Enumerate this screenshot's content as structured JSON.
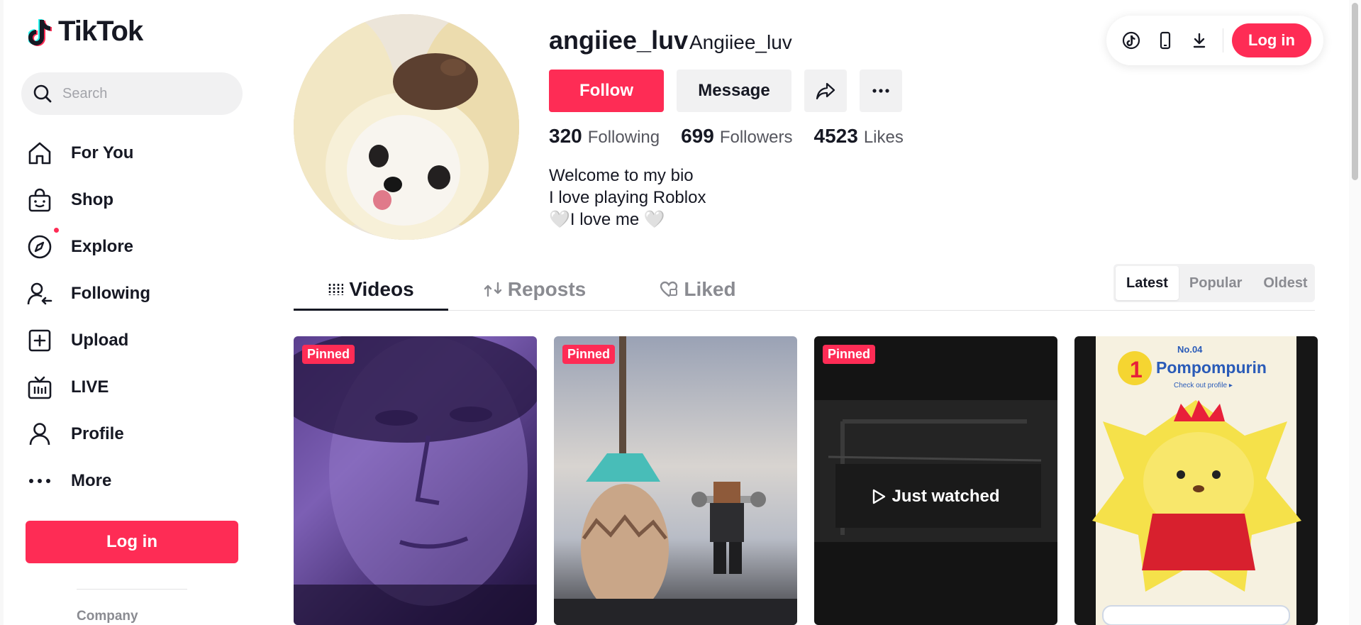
{
  "sidebar": {
    "logo": "TikTok",
    "search_placeholder": "Search",
    "items": [
      {
        "label": "For You",
        "icon": "home-icon"
      },
      {
        "label": "Shop",
        "icon": "shop-bag-icon"
      },
      {
        "label": "Explore",
        "icon": "compass-icon"
      },
      {
        "label": "Following",
        "icon": "following-user-icon"
      },
      {
        "label": "Upload",
        "icon": "upload-plus-icon"
      },
      {
        "label": "LIVE",
        "icon": "live-tv-icon"
      },
      {
        "label": "Profile",
        "icon": "profile-user-icon"
      },
      {
        "label": "More",
        "icon": "more-dots-icon"
      }
    ],
    "login_label": "Log in",
    "company_label": "Company"
  },
  "topbar": {
    "icons": [
      "tiktok-coin-icon",
      "mobile-phone-icon",
      "download-icon"
    ],
    "login_label": "Log in"
  },
  "profile": {
    "username": "angiiee_luv",
    "nickname": "Angiiee_luv",
    "follow_label": "Follow",
    "message_label": "Message",
    "stats": [
      {
        "value": "320",
        "label": "Following"
      },
      {
        "value": "699",
        "label": "Followers"
      },
      {
        "value": "4523",
        "label": "Likes"
      }
    ],
    "bio": [
      "Welcome to my bio",
      "I love playing Roblox",
      "🤍I love me 🤍"
    ]
  },
  "tabs": [
    {
      "label": "Videos",
      "icon": "videos-grid-icon",
      "active": true
    },
    {
      "label": "Reposts",
      "icon": "repost-icon",
      "active": false
    },
    {
      "label": "Liked",
      "icon": "liked-heart-icon",
      "active": false
    }
  ],
  "sort": {
    "options": [
      "Latest",
      "Popular",
      "Oldest"
    ],
    "active": "Latest"
  },
  "videos": [
    {
      "badge": "Pinned",
      "overlay": ""
    },
    {
      "badge": "Pinned",
      "overlay": ""
    },
    {
      "badge": "Pinned",
      "overlay": "Just watched"
    },
    {
      "badge": "",
      "overlay": "",
      "title_art": "Pompompurin",
      "number_art": "No.04",
      "subtitle_art": "Check out profile ▸"
    }
  ],
  "colors": {
    "brand": "#fe2c55",
    "text": "#161823",
    "muted": "#8a8b91",
    "surface": "#f1f1f2"
  }
}
